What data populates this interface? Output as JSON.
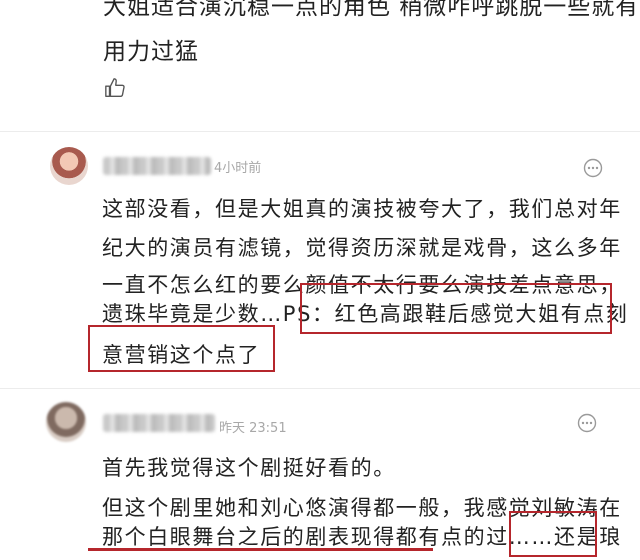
{
  "top_comment": {
    "line1": "大姐适合演沉稳一点的角色 稍微咋呼跳脱一些就有些",
    "line2": "用力过猛",
    "like_icon": "thumbs-up-icon"
  },
  "comments": [
    {
      "username": "",
      "timestamp": "4小时前",
      "lines": [
        "这部没看，但是大姐真的演技被夸大了，我们总对年",
        "纪大的演员有滤镜，觉得资历深就是戏骨，这么多年",
        "一直不怎么红的要么颜值不太行要么演技差点意思，",
        "遗珠毕竟是少数…PS：红色高跟鞋后感觉大姐有点刻",
        "意营销这个点了"
      ],
      "avatar_icon": "avatar-image",
      "more_icon": "more-options-icon"
    },
    {
      "username": "",
      "timestamp": "昨天 23:51",
      "lines": [
        "首先我觉得这个剧挺好看的。",
        "但这个剧里她和刘心悠演得都一般，我感觉刘敏涛在",
        "那个白眼舞台之后的剧表现得都有点的过……还是琅"
      ],
      "avatar_icon": "avatar-image",
      "more_icon": "more-options-icon"
    }
  ],
  "colors": {
    "highlight_box": "#b5262c",
    "timestamp": "#a8a8a8",
    "text": "#222222"
  }
}
